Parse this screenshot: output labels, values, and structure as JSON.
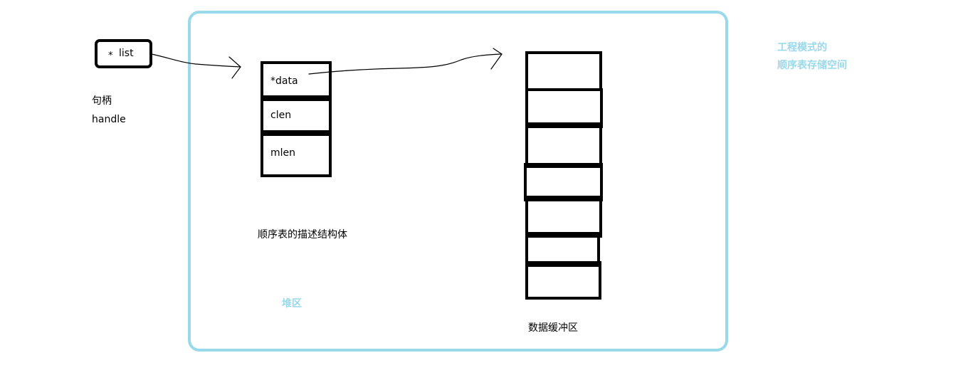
{
  "handle": {
    "star": "*",
    "name": "list",
    "caption_cn": "句柄",
    "caption_en": "handle"
  },
  "struct": {
    "fields": [
      "*data",
      "clen",
      "mlen"
    ],
    "caption": "顺序表的描述结构体"
  },
  "heap": {
    "label": "堆区"
  },
  "buffer": {
    "cell_count": 7,
    "caption": "数据缓冲区"
  },
  "engineering_note": {
    "line1": "工程模式的",
    "line2": "顺序表存储空间"
  },
  "colors": {
    "heap_border": "#99d9ea",
    "annotation_text": "#99d9ea",
    "box_border": "#000000"
  }
}
